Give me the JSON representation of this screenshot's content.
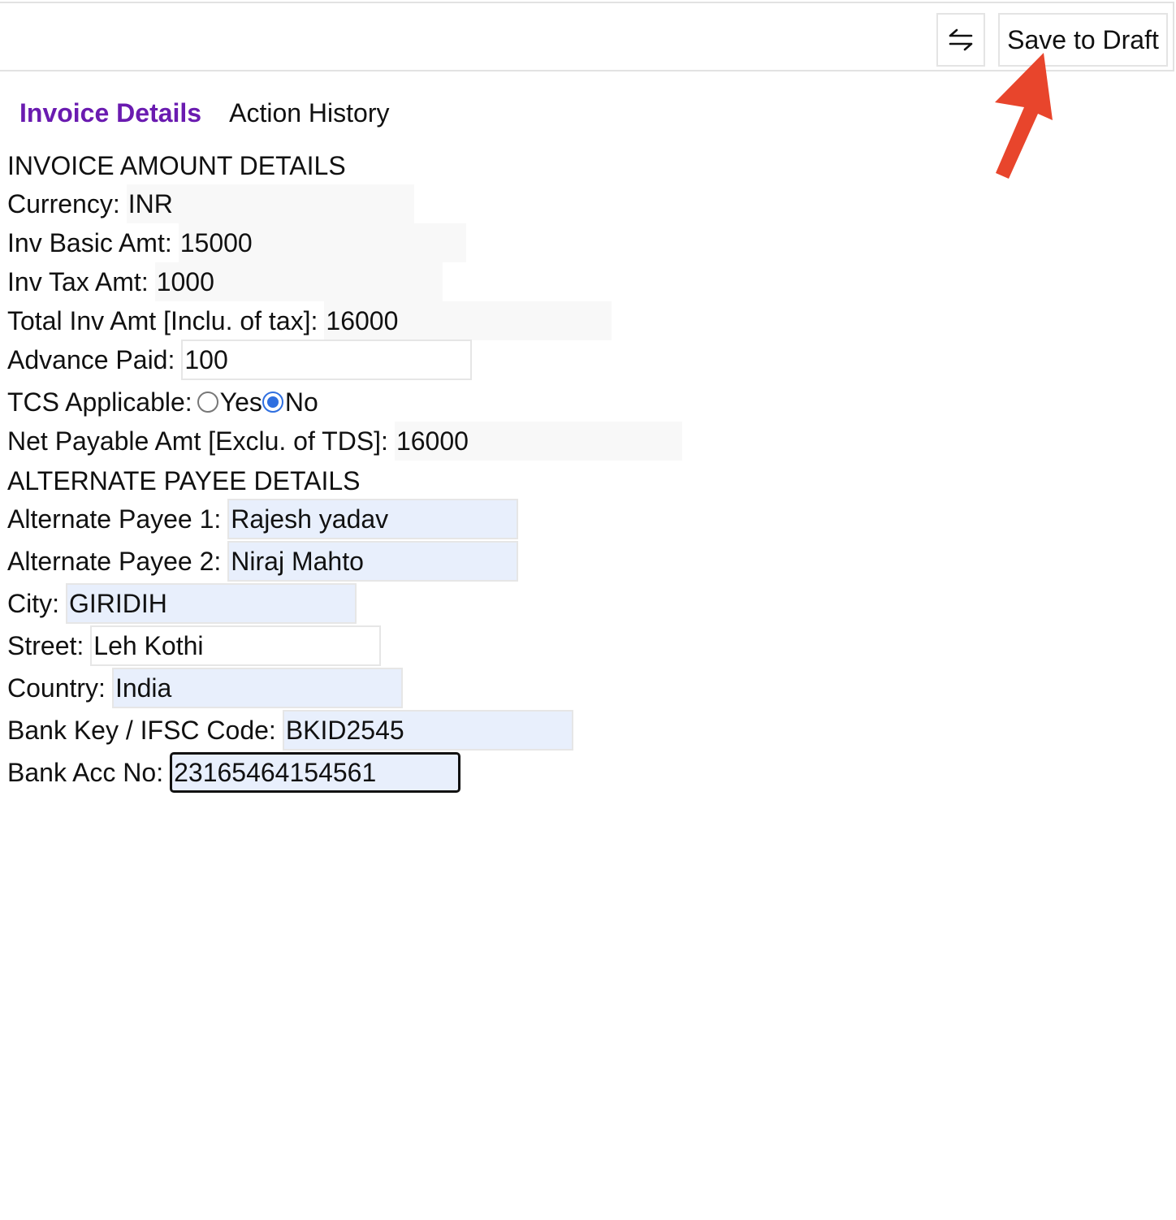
{
  "toolbar": {
    "swap_icon": "swap-arrows-icon",
    "save_label": "Save to Draft"
  },
  "annotation": {
    "arrow_color": "#e8452c"
  },
  "tabs": [
    {
      "label": "Invoice Details",
      "active": true
    },
    {
      "label": "Action History",
      "active": false
    }
  ],
  "invoice": {
    "section_title": "INVOICE AMOUNT DETAILS",
    "currency_label": "Currency:",
    "currency_value": "INR",
    "basic_label": "Inv Basic Amt:",
    "basic_value": "15000",
    "tax_label": "Inv Tax Amt:",
    "tax_value": "1000",
    "total_label": "Total Inv Amt [Inclu. of tax]:",
    "total_value": "16000",
    "advance_label": "Advance Paid:",
    "advance_value": "100",
    "tcs_label": "TCS Applicable:",
    "tcs_options": [
      "Yes",
      "No"
    ],
    "tcs_selected": "No",
    "net_label": "Net Payable Amt [Exclu. of TDS]:",
    "net_value": "16000"
  },
  "payee": {
    "section_title": "ALTERNATE PAYEE DETAILS",
    "payee1_label": "Alternate Payee 1:",
    "payee1_value": "Rajesh yadav",
    "payee2_label": "Alternate Payee 2:",
    "payee2_value": "Niraj Mahto",
    "city_label": "City:",
    "city_value": "GIRIDIH",
    "street_label": "Street:",
    "street_value": "Leh Kothi",
    "country_label": "Country:",
    "country_value": "India",
    "bank_key_label": "Bank Key / IFSC Code:",
    "bank_key_value": "BKID2545",
    "acc_label": "Bank Acc No:",
    "acc_value": "23165464154561"
  },
  "colors": {
    "accent_tab": "#6a1bb0",
    "autofill_bg": "#e8effc",
    "radio_blue": "#2f6fe0"
  }
}
